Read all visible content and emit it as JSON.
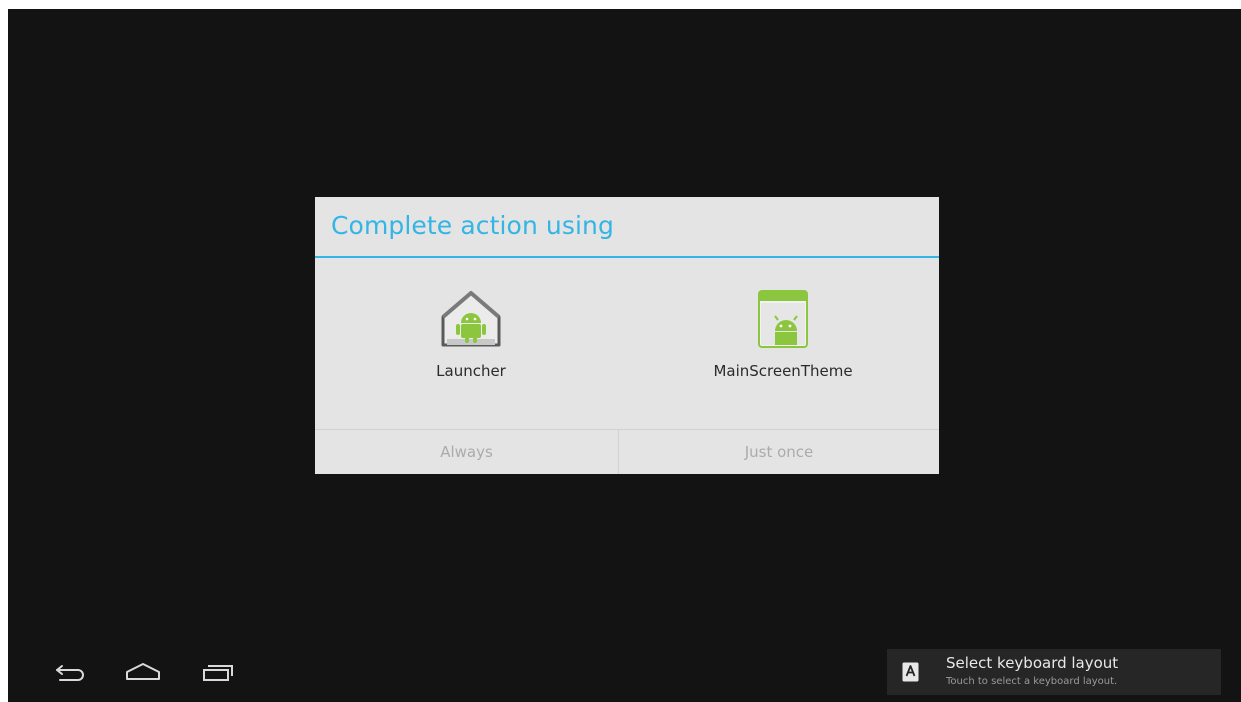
{
  "dialog": {
    "title": "Complete action using",
    "options": [
      {
        "label": "Launcher",
        "icon": "launcher-app-icon"
      },
      {
        "label": "MainScreenTheme",
        "icon": "mainscreentheme-app-icon"
      }
    ],
    "buttons": {
      "always": "Always",
      "just_once": "Just once"
    },
    "accent_color": "#33b5e5"
  },
  "navigation": {
    "back_icon": "back-icon",
    "home_icon": "home-icon",
    "recent_icon": "recent-apps-icon"
  },
  "notification": {
    "icon": "keyboard-icon",
    "title": "Select keyboard layout",
    "subtitle": "Touch to select a keyboard layout."
  }
}
